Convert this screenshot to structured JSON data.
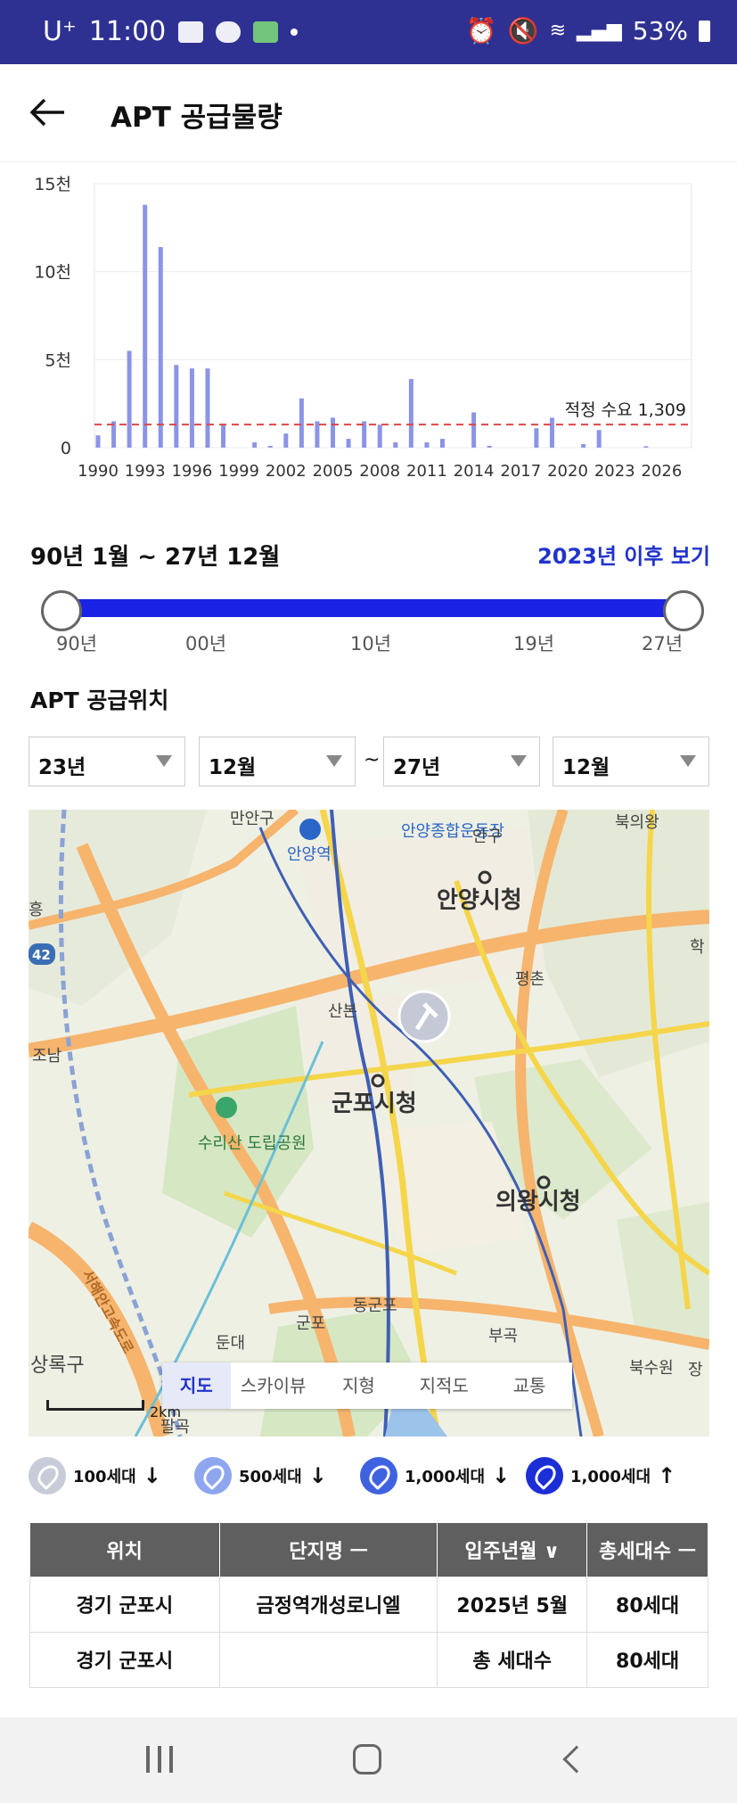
{
  "status_bar": {
    "carrier": "U⁺",
    "time": "11:00",
    "battery": "53%"
  },
  "app_bar": {
    "title": "APT 공급물량"
  },
  "chart_data": {
    "type": "bar",
    "x": [
      1990,
      1991,
      1992,
      1993,
      1994,
      1995,
      1996,
      1997,
      1998,
      1999,
      2000,
      2001,
      2002,
      2003,
      2004,
      2005,
      2006,
      2007,
      2008,
      2009,
      2010,
      2011,
      2012,
      2013,
      2014,
      2015,
      2016,
      2017,
      2018,
      2019,
      2020,
      2021,
      2022,
      2023,
      2024,
      2025,
      2026,
      2027
    ],
    "values": [
      700,
      1500,
      5500,
      13800,
      11400,
      4700,
      4500,
      4500,
      1300,
      0,
      300,
      100,
      800,
      2800,
      1500,
      1700,
      500,
      1500,
      1300,
      300,
      3900,
      300,
      500,
      0,
      2000,
      100,
      0,
      0,
      1100,
      1700,
      0,
      200,
      1000,
      0,
      0,
      80,
      0,
      0
    ],
    "x_tick_labels": [
      "1990",
      "1993",
      "1996",
      "1999",
      "2002",
      "2005",
      "2008",
      "2011",
      "2014",
      "2017",
      "2020",
      "2023",
      "2026"
    ],
    "y_tick_labels": [
      "0",
      "5천",
      "10천",
      "15천"
    ],
    "ylim": [
      0,
      15000
    ],
    "reference_line": {
      "label": "적정 수요 1,309",
      "value": 1309,
      "color": "#e04545"
    },
    "bar_color": "#8b94e6",
    "grid": true,
    "title": "",
    "xlabel": "",
    "ylabel": ""
  },
  "range": {
    "title": "90년 1월 ~ 27년 12월",
    "link": "2023년 이후 보기",
    "slider_start": 0.0,
    "slider_end": 1.0,
    "labels": [
      "90년",
      "00년",
      "10년",
      "19년",
      "27년"
    ]
  },
  "location": {
    "title": "APT 공급위치",
    "selects": {
      "from_year": "23년",
      "from_month": "12월",
      "separator": "~",
      "to_year": "27년",
      "to_month": "12월"
    }
  },
  "map": {
    "labels": {
      "anyang_city_hall": "안양시청",
      "gunpo_city_hall": "군포시청",
      "uiwang_city_hall": "의왕시청",
      "anyang_station": "안양역",
      "sports_complex": "안양종합운동장",
      "suri_park": "수리산 도립공원",
      "sanbon": "산본",
      "pyeongchon": "평촌",
      "gunpo": "군포",
      "dongunpo": "동군포",
      "bugok": "부곡",
      "dundae": "둔대",
      "sangnok": "상록구",
      "bukuiwang": "북의왕",
      "bugsuwon": "북수원",
      "joman": "조남",
      "manan": "만안구",
      "angu": "안구",
      "road_42": "42",
      "seohaean": "서해안고속도로",
      "heung": "흥",
      "hak": "학",
      "palgok": "팔곡",
      "jang": "장"
    },
    "tabs": [
      "지도",
      "스카이뷰",
      "지형",
      "지적도",
      "교통"
    ],
    "active_tab": "지도",
    "scale": "2km"
  },
  "legend": [
    {
      "label": "100세대",
      "arrow": "↓",
      "color": "#c8ccd8"
    },
    {
      "label": "500세대",
      "arrow": "↓",
      "color": "#8ea6ee"
    },
    {
      "label": "1,000세대",
      "arrow": "↓",
      "color": "#3f63e0"
    },
    {
      "label": "1,000세대",
      "arrow": "↑",
      "color": "#1c2ed6"
    }
  ],
  "table": {
    "headers": [
      "위치",
      "단지명 ㅡ",
      "입주년월 ∨",
      "총세대수 ㅡ"
    ],
    "rows": [
      [
        "경기 군포시",
        "금정역개성로니엘",
        "2025년 5월",
        "80세대"
      ],
      [
        "경기 군포시",
        "",
        "총 세대수",
        "80세대"
      ]
    ]
  }
}
